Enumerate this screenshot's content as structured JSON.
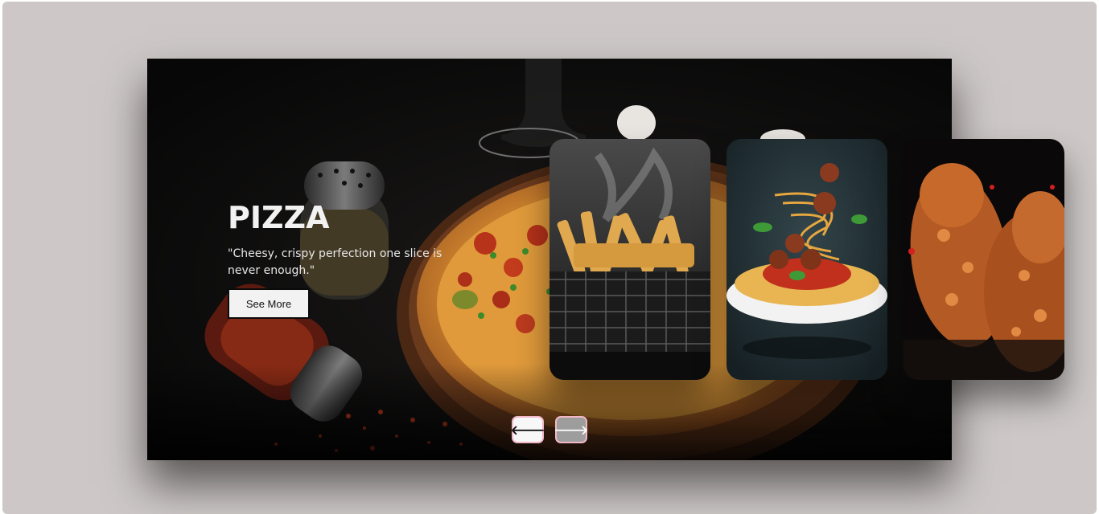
{
  "slider": {
    "active": {
      "name": "PIZZA",
      "description": "\"Cheesy, crispy perfection one slice is never enough.\"",
      "button_label": "See More",
      "image_icon": "pizza-photo"
    },
    "queue": [
      {
        "image_icon": "fries-photo"
      },
      {
        "image_icon": "spaghetti-photo"
      },
      {
        "image_icon": "fried-chicken-photo"
      }
    ]
  },
  "navigation": {
    "prev_icon": "arrow-left-icon",
    "next_icon": "arrow-right-icon",
    "prev_glyph": "🡐",
    "next_glyph": "🡒"
  },
  "colors": {
    "page_bg": "#cdc8c7",
    "slider_bg": "#0e0d0d",
    "button_border": "#f1b7c7",
    "next_button_bg": "#9d9d9d"
  }
}
